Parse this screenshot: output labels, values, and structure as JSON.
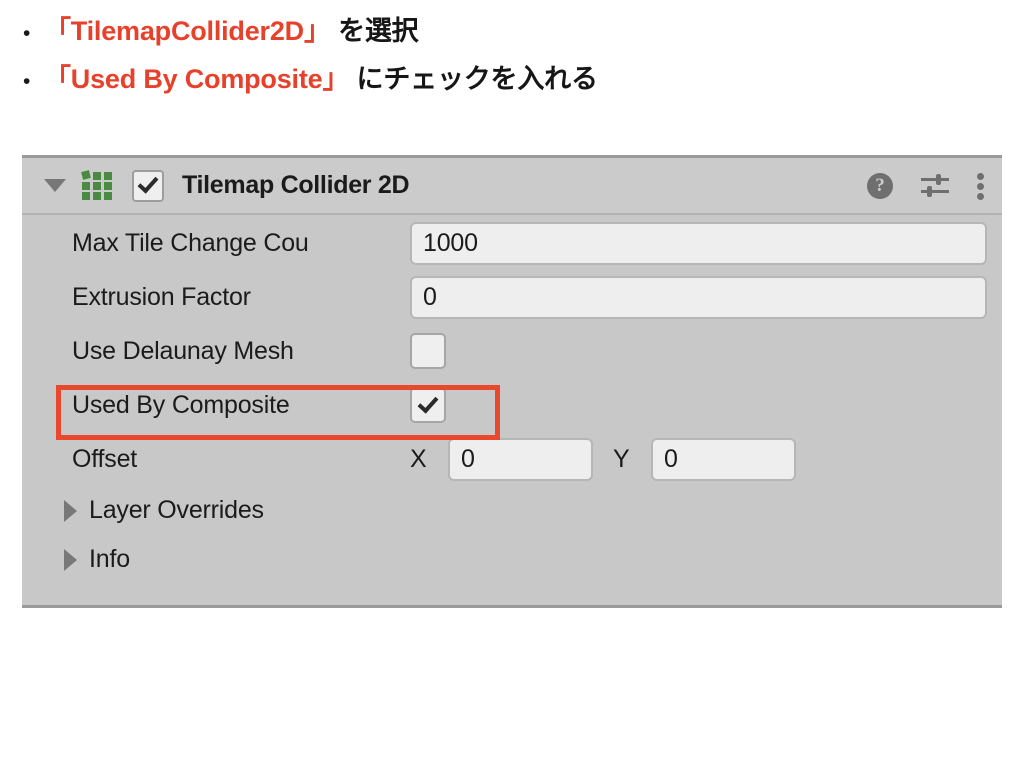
{
  "bullets": [
    {
      "marker": "•",
      "quoted": "「TilemapCollider2D」",
      "suffix": " を選択"
    },
    {
      "marker": "•",
      "quoted": "「Used By Composite」",
      "suffix": " にチェックを入れる"
    }
  ],
  "colors": {
    "highlight_red": "#e8412b",
    "annotation_box": "#e8492c",
    "panel_bg": "#c8c8c8",
    "header_bg": "#cbcbcb",
    "tilemap_icon_green": "#4a8a43",
    "field_bg": "#eeeeee"
  },
  "inspector": {
    "header": {
      "foldout_icon": "triangle-down-icon",
      "component_icon": "tilemap-grid-icon",
      "enabled_checkbox": {
        "icon": "checkmark-icon",
        "checked": true
      },
      "title": "Tilemap Collider 2D",
      "actions": [
        {
          "name": "help-icon",
          "glyph": "?"
        },
        {
          "name": "preset-icon",
          "glyph": "sliders"
        },
        {
          "name": "kebab-menu-icon",
          "glyph": "three-dots-vertical"
        }
      ]
    },
    "properties": [
      {
        "label": "Max Tile Change Cou",
        "type": "text",
        "value": "1000"
      },
      {
        "label": "Extrusion Factor",
        "type": "text",
        "value": "0"
      },
      {
        "label": "Use Delaunay Mesh",
        "type": "checkbox",
        "checked": false
      },
      {
        "label": "Used By Composite",
        "type": "checkbox",
        "checked": true,
        "highlighted": true
      }
    ],
    "offset": {
      "label": "Offset",
      "x_label": "X",
      "x_value": "0",
      "y_label": "Y",
      "y_value": "0"
    },
    "foldouts": [
      {
        "label": "Layer Overrides",
        "expanded": false
      },
      {
        "label": "Info",
        "expanded": false
      }
    ]
  }
}
